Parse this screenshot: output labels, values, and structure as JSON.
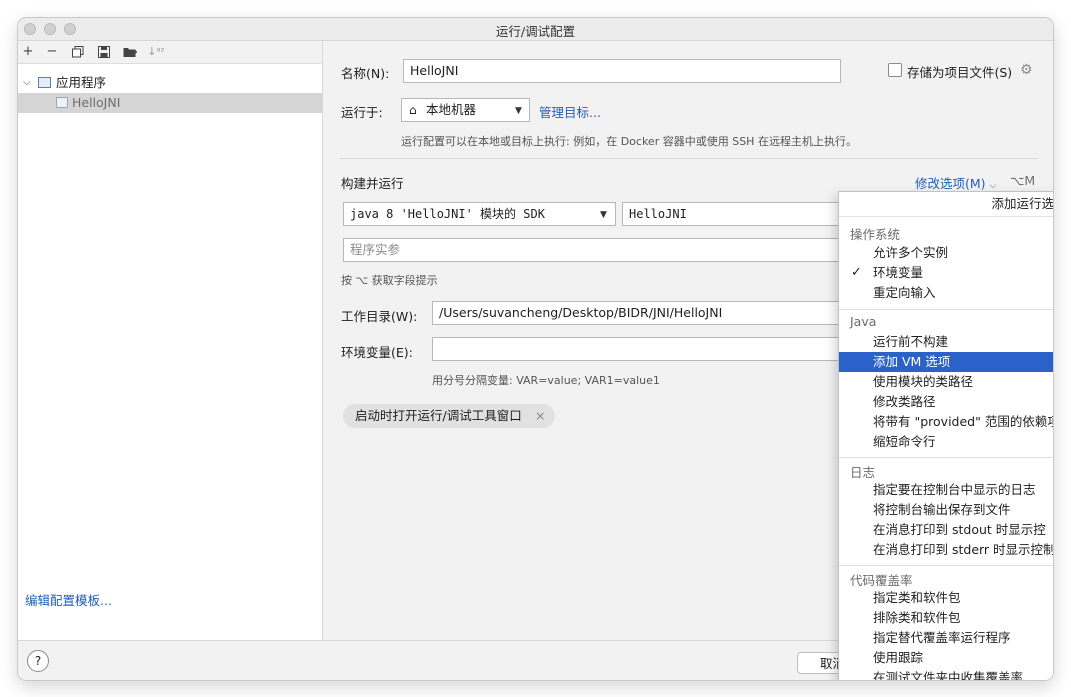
{
  "window": {
    "title": "运行/调试配置"
  },
  "toolbar": {
    "add": "+",
    "remove": "−",
    "copy": "⧉",
    "save": "💾",
    "folder": "📁",
    "sort": "↓ᵃᶻ"
  },
  "tree": {
    "group_label": "应用程序",
    "item_label": "HelloJNI"
  },
  "left_footer": {
    "edit_templates": "编辑配置模板..."
  },
  "form": {
    "name_label": "名称(N):",
    "name_value": "HelloJNI",
    "store_label": "存储为项目文件(S)",
    "run_on_label": "运行于:",
    "run_on_value": "本地机器",
    "manage_targets": "管理目标...",
    "run_on_hint": "运行配置可以在本地或目标上执行: 例如，在 Docker 容器中或使用 SSH 在远程主机上执行。",
    "build_run_label": "构建并运行",
    "modify_options": "修改选项(M)",
    "modify_shortcut": "⌥M",
    "sdk_value": "java 8 'HelloJNI' 模块的 SDK",
    "main_class": "HelloJNI",
    "program_args_placeholder": "程序实参",
    "field_hint": "按 ⌥ 获取字段提示",
    "workdir_label": "工作目录(W):",
    "workdir_value": "/Users/suvancheng/Desktop/BIDR/JNI/HelloJNI",
    "env_label": "环境变量(E):",
    "env_value": "",
    "env_hint": "用分号分隔变量: VAR=value; VAR1=value1",
    "chip_label": "启动时打开运行/调试工具窗口",
    "chip_close": "×"
  },
  "bottom": {
    "help": "?",
    "cancel": "取消"
  },
  "popup": {
    "title": "添加运行选",
    "groups": [
      {
        "name": "操作系统",
        "items": [
          "允许多个实例",
          "环境变量",
          "重定向输入"
        ]
      },
      {
        "name": "Java",
        "items": [
          "运行前不构建",
          "添加 VM 选项",
          "使用模块的类路径",
          "修改类路径",
          "将带有 \"provided\" 范围的依赖项",
          "缩短命令行"
        ]
      },
      {
        "name": "日志",
        "items": [
          "指定要在控制台中显示的日志",
          "将控制台输出保存到文件",
          "在消息打印到 stdout 时显示控",
          "在消息打印到 stderr 时显示控制"
        ]
      },
      {
        "name": "代码覆盖率",
        "items": [
          "指定类和软件包",
          "排除类和软件包",
          "指定替代覆盖率运行程序",
          "使用跟踪",
          "在测试文件夹中收集覆盖率"
        ]
      }
    ],
    "checked": "✓"
  }
}
